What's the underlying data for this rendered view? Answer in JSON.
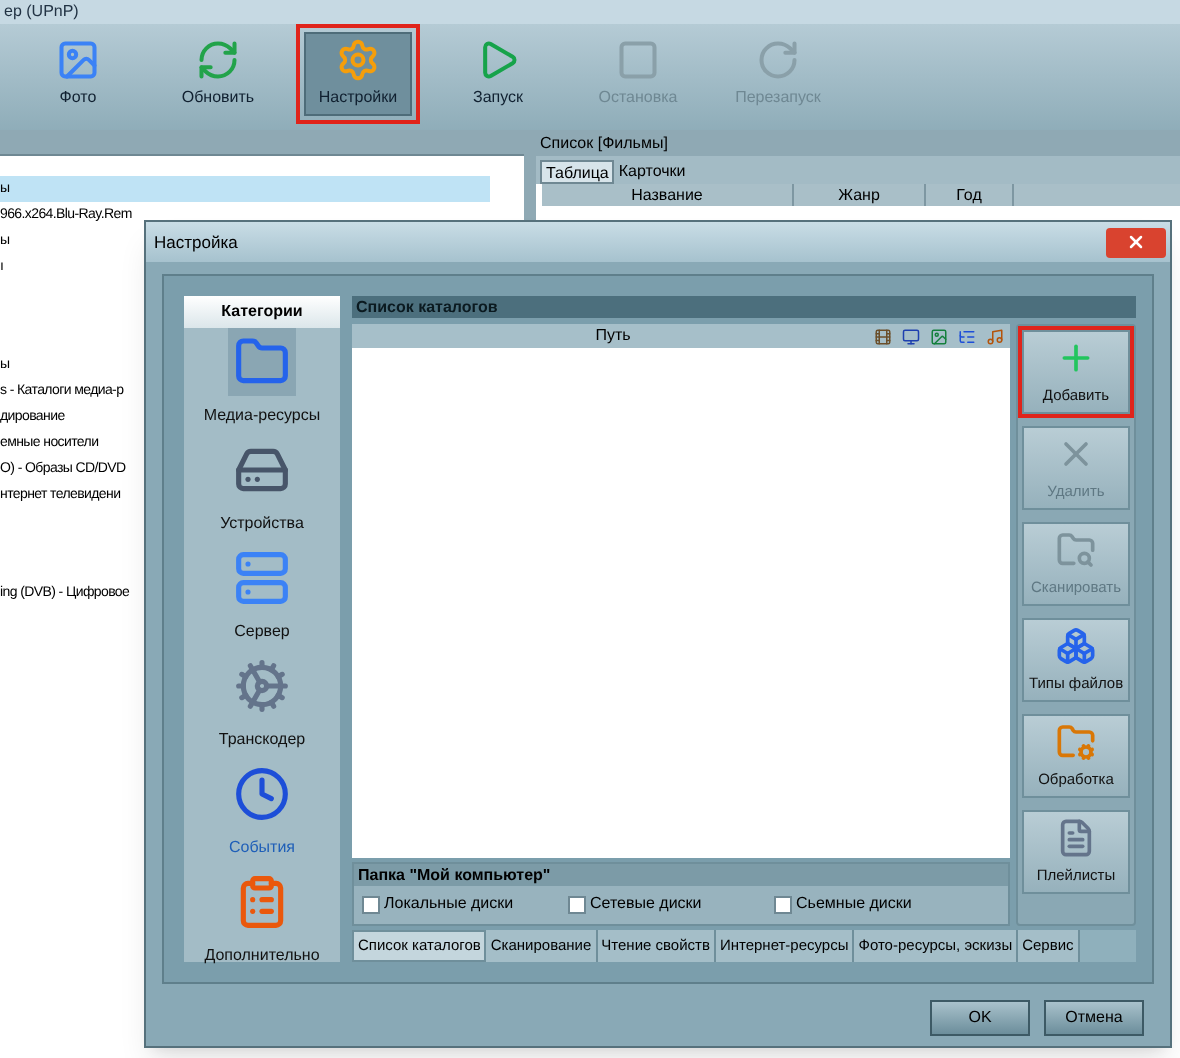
{
  "app": {
    "title": "ер (UPnP)"
  },
  "toolbar": [
    {
      "label": "Фото",
      "pressed": false,
      "disabled": false,
      "highlighted": false
    },
    {
      "label": "Обновить",
      "pressed": false,
      "disabled": false,
      "highlighted": false
    },
    {
      "label": "Настройки",
      "pressed": true,
      "disabled": false,
      "highlighted": true
    },
    {
      "label": "Запуск",
      "pressed": false,
      "disabled": false,
      "highlighted": false
    },
    {
      "label": "Остановка",
      "pressed": false,
      "disabled": true,
      "highlighted": false
    },
    {
      "label": "Перезапуск",
      "pressed": false,
      "disabled": true,
      "highlighted": false
    }
  ],
  "tree": {
    "groups": [
      [
        {
          "text": "ы",
          "selected": true
        },
        {
          "text": "966.x264.Blu-Ray.Rem",
          "selected": false
        },
        {
          "text": "ы",
          "selected": false
        },
        {
          "text": "ı",
          "selected": false
        }
      ],
      [
        {
          "text": "ы",
          "selected": false
        },
        {
          "text": "s - Каталоги медиа-р",
          "selected": false
        },
        {
          "text": "дирование",
          "selected": false
        },
        {
          "text": "емные носители",
          "selected": false
        },
        {
          "text": "О) - Образы CD/DVD",
          "selected": false
        },
        {
          "text": "нтернет телевидени",
          "selected": false
        }
      ],
      [
        {
          "text": "ing (DVB) - Цифровое",
          "selected": false
        }
      ]
    ]
  },
  "list_panel": {
    "title": "Список [Фильмы]",
    "tabs": [
      {
        "label": "Таблица",
        "selected": true
      },
      {
        "label": "Карточки",
        "selected": false
      }
    ],
    "columns": [
      "Название",
      "Жанр",
      "Год"
    ]
  },
  "dialog": {
    "title": "Настройка",
    "categories_title": "Категории",
    "categories": [
      {
        "label": "Медиа-ресурсы",
        "selected": true,
        "hovered": false
      },
      {
        "label": "Устройства",
        "selected": false,
        "hovered": false
      },
      {
        "label": "Сервер",
        "selected": false,
        "hovered": false
      },
      {
        "label": "Транскодер",
        "selected": false,
        "hovered": false
      },
      {
        "label": "События",
        "selected": false,
        "hovered": true
      },
      {
        "label": "Дополнительно",
        "selected": false,
        "hovered": false
      }
    ],
    "section_title": "Список каталогов",
    "path_column": "Путь",
    "side_buttons": [
      {
        "label": "Добавить",
        "disabled": false,
        "highlighted": true
      },
      {
        "label": "Удалить",
        "disabled": true,
        "highlighted": false
      },
      {
        "label": "Сканировать",
        "disabled": true,
        "highlighted": false
      },
      {
        "label": "Типы файлов",
        "disabled": false,
        "highlighted": false
      },
      {
        "label": "Обработка",
        "disabled": false,
        "highlighted": false
      },
      {
        "label": "Плейлисты",
        "disabled": false,
        "highlighted": false
      }
    ],
    "folder_group": {
      "title": "Папка \"Мой компьютер\"",
      "options": [
        {
          "label": "Локальные диски",
          "checked": false
        },
        {
          "label": "Сетевые диски",
          "checked": false
        },
        {
          "label": "Сьемные диски",
          "checked": false
        }
      ]
    },
    "tabs": [
      {
        "label": "Список каталогов",
        "selected": true
      },
      {
        "label": "Сканирование",
        "selected": false
      },
      {
        "label": "Чтение свойств",
        "selected": false
      },
      {
        "label": "Интернет-ресурсы",
        "selected": false
      },
      {
        "label": "Фото-ресурсы, эскизы",
        "selected": false
      },
      {
        "label": "Сервис",
        "selected": false
      }
    ],
    "buttons": [
      "OK",
      "Отмена"
    ]
  }
}
